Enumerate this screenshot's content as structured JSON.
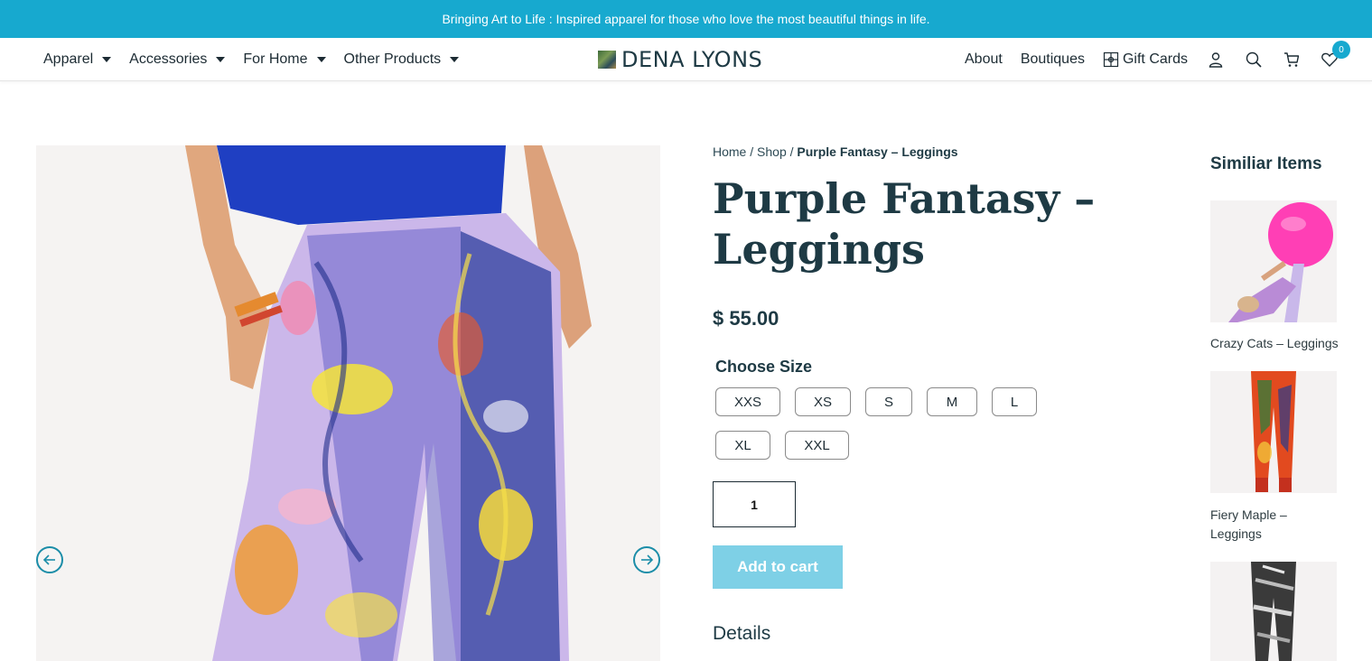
{
  "promo": {
    "text": "Bringing Art to Life : Inspired apparel for those who love the most beautiful things in life."
  },
  "nav": {
    "left": [
      "Apparel",
      "Accessories",
      "For Home",
      "Other Products"
    ],
    "logo": "DENA LYONS",
    "right": [
      "About",
      "Boutiques",
      "Gift Cards"
    ],
    "icons": [
      "user-icon",
      "search-icon",
      "cart-icon",
      "wishlist-heart-icon"
    ],
    "wishlist_count": "0"
  },
  "breadcrumb": {
    "home": "Home",
    "sep": " / ",
    "shop": "Shop",
    "current": "Purple Fantasy – Leggings"
  },
  "product": {
    "title": "Purple Fantasy – Leggings",
    "price": "$ 55.00",
    "size_label": "Choose Size",
    "sizes": [
      "XXS",
      "XS",
      "S",
      "M",
      "L",
      "XL",
      "XXL"
    ],
    "quantity": "1",
    "add_to_cart": "Add to cart",
    "details_heading": "Details"
  },
  "similar": {
    "title": "Similiar Items",
    "items": [
      {
        "name": "Crazy Cats – Leggings"
      },
      {
        "name": "Fiery Maple – Leggings"
      },
      {
        "name": ""
      }
    ]
  },
  "colors": {
    "accent": "#17a9cf",
    "heading": "#1e3a44",
    "button": "#7ed0e6"
  }
}
